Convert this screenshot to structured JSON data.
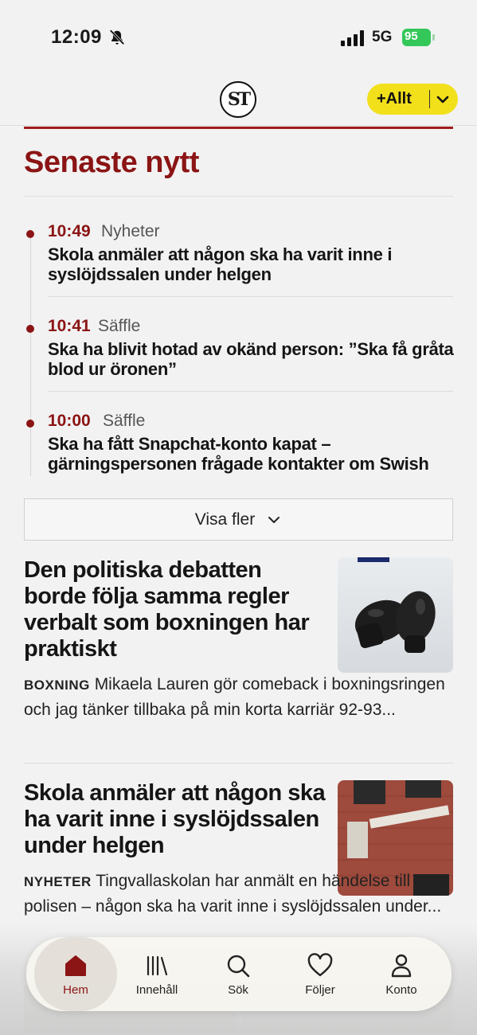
{
  "status_bar": {
    "time": "12:09",
    "network": "5G",
    "battery": "95"
  },
  "header": {
    "logo_text": "ST",
    "filter_button_label": "+Allt"
  },
  "latest": {
    "title": "Senaste nytt",
    "items": [
      {
        "time": "10:49",
        "category": "Nyheter",
        "headline": "Skola anmäler att någon ska ha varit inne i syslöjdssalen under helgen"
      },
      {
        "time": "10:41",
        "category": "Säffle",
        "headline": "Ska ha blivit hotad av okänd person: ”Ska få gråta blod ur öronen”"
      },
      {
        "time": "10:00",
        "category": "Säffle",
        "headline": "Ska ha fått Snapchat-konto kapat – gärningspersonen frågade kontakter om Swish"
      }
    ],
    "more_label": "Visa fler"
  },
  "articles": [
    {
      "title": "Den politiska debatten borde följa samma regler verbalt som boxningen har praktiskt",
      "kicker": "BOXNING",
      "lead": "Mikaela Lauren gör comeback i boxningsringen och jag tänker tillbaka på min korta karriär 92-93..."
    },
    {
      "title": "Skola anmäler att någon ska ha varit inne i syslöjdssalen under helgen",
      "kicker": "NYHETER",
      "lead": "Tingvallaskolan har anmält en händelse till polisen – någon ska ha varit inne i syslöjdssalen under..."
    }
  ],
  "tab_bar": {
    "items": [
      {
        "label": "Hem",
        "icon": "home-icon",
        "active": true
      },
      {
        "label": "Innehåll",
        "icon": "library-icon",
        "active": false
      },
      {
        "label": "Sök",
        "icon": "search-icon",
        "active": false
      },
      {
        "label": "Följer",
        "icon": "heart-icon",
        "active": false
      },
      {
        "label": "Konto",
        "icon": "person-icon",
        "active": false
      }
    ]
  },
  "colors": {
    "accent": "#8b1414",
    "highlight": "#f2e01b",
    "battery": "#34c759"
  }
}
